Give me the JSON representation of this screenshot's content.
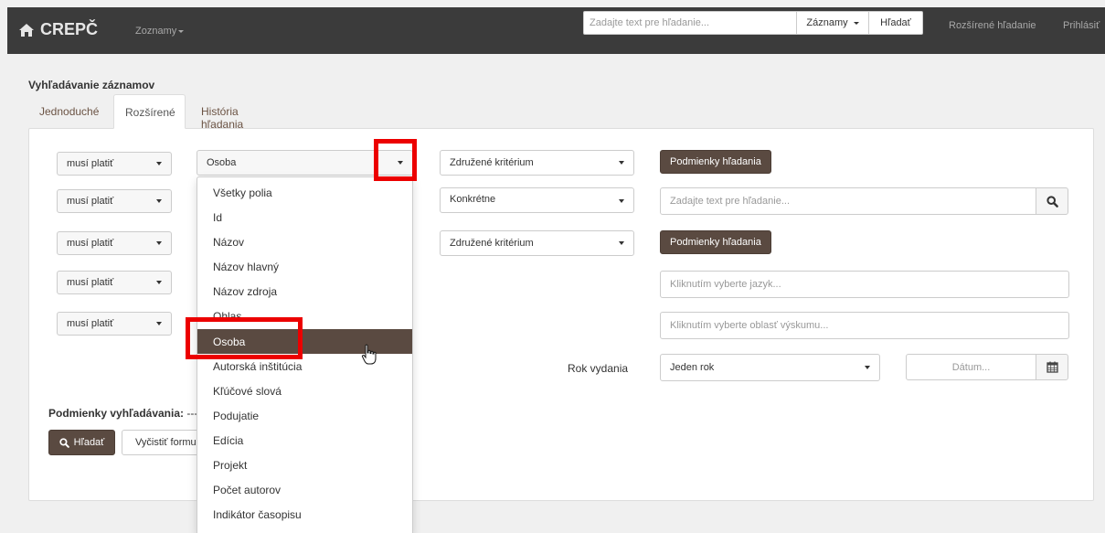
{
  "navbar": {
    "brand": "CREPČ",
    "menu_zoznamy": "Zoznamy",
    "search_placeholder": "Zadajte text pre hľadanie...",
    "search_scope": "Záznamy",
    "search_button": "Hľadať",
    "advanced_search": "Rozšírené hľadanie",
    "login": "Prihlásiť"
  },
  "page": {
    "title": "Vyhľadávanie záznamov",
    "tabs": [
      "Jednoduché",
      "Rozšírené",
      "História hľadania"
    ],
    "active_tab": "Rozšírené"
  },
  "rows": [
    {
      "operator": "musí platiť",
      "field": "Osoba",
      "criterion": "Združené kritérium",
      "action": "Podmienky hľadania"
    },
    {
      "operator": "musí platiť",
      "criterion": "Konkrétne",
      "input_placeholder": "Zadajte text pre hľadanie..."
    },
    {
      "operator": "musí platiť",
      "criterion": "Združené kritérium",
      "action": "Podmienky hľadania"
    },
    {
      "operator": "musí platiť",
      "input_placeholder": "Kliknutím vyberte jazyk..."
    },
    {
      "operator": "musí platiť",
      "input_placeholder": "Kliknutím vyberte oblasť výskumu..."
    }
  ],
  "year": {
    "label": "Rok vydania",
    "mode": "Jeden rok",
    "date_placeholder": "Dátum..."
  },
  "conditions": {
    "label": "Podmienky vyhľadávania:",
    "value": "---"
  },
  "buttons": {
    "search": "Hľadať",
    "clear": "Vyčistiť formulár"
  },
  "dropdown": {
    "items": [
      "Všetky polia",
      "Id",
      "Názov",
      "Názov hlavný",
      "Názov zdroja",
      "Ohlas",
      "Osoba",
      "Autorská inštitúcia",
      "Kľúčové slová",
      "Podujatie",
      "Edícia",
      "Projekt",
      "Počet autorov",
      "Indikátor časopisu"
    ],
    "selected": "Osoba"
  },
  "colors": {
    "navbar": "#3b3b3b",
    "accent_brown": "#5a4a41",
    "highlight_red": "#ec0000"
  }
}
